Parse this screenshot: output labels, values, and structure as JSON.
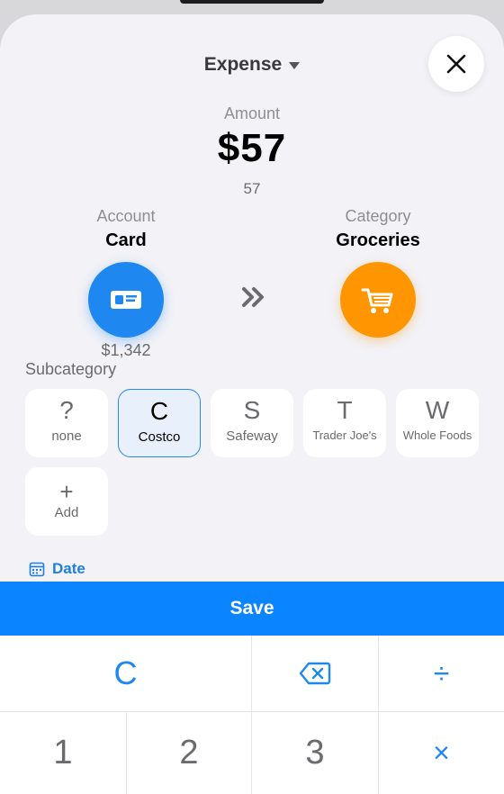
{
  "header": {
    "type_label": "Expense"
  },
  "amount": {
    "label": "Amount",
    "value": "$57",
    "raw": "57"
  },
  "account": {
    "label": "Account",
    "name": "Card",
    "balance": "$1,342"
  },
  "category": {
    "label": "Category",
    "name": "Groceries"
  },
  "subcategory": {
    "title": "Subcategory",
    "items": [
      {
        "letter": "?",
        "name": "none"
      },
      {
        "letter": "C",
        "name": "Costco"
      },
      {
        "letter": "S",
        "name": "Safeway"
      },
      {
        "letter": "T",
        "name": "Trader Joe's"
      },
      {
        "letter": "W",
        "name": "Whole Foods"
      }
    ],
    "add": {
      "symbol": "+",
      "label": "Add"
    },
    "selected": "Costco"
  },
  "date": {
    "label": "Date"
  },
  "save": {
    "label": "Save"
  },
  "keypad": {
    "clear": "C",
    "keys": [
      "1",
      "2",
      "3"
    ],
    "divide": "÷",
    "multiply": "×"
  },
  "colors": {
    "accent": "#0a84ff",
    "account_circle": "#1e88f0",
    "category_circle": "#ff9500",
    "selected_border": "#2a86e8"
  }
}
